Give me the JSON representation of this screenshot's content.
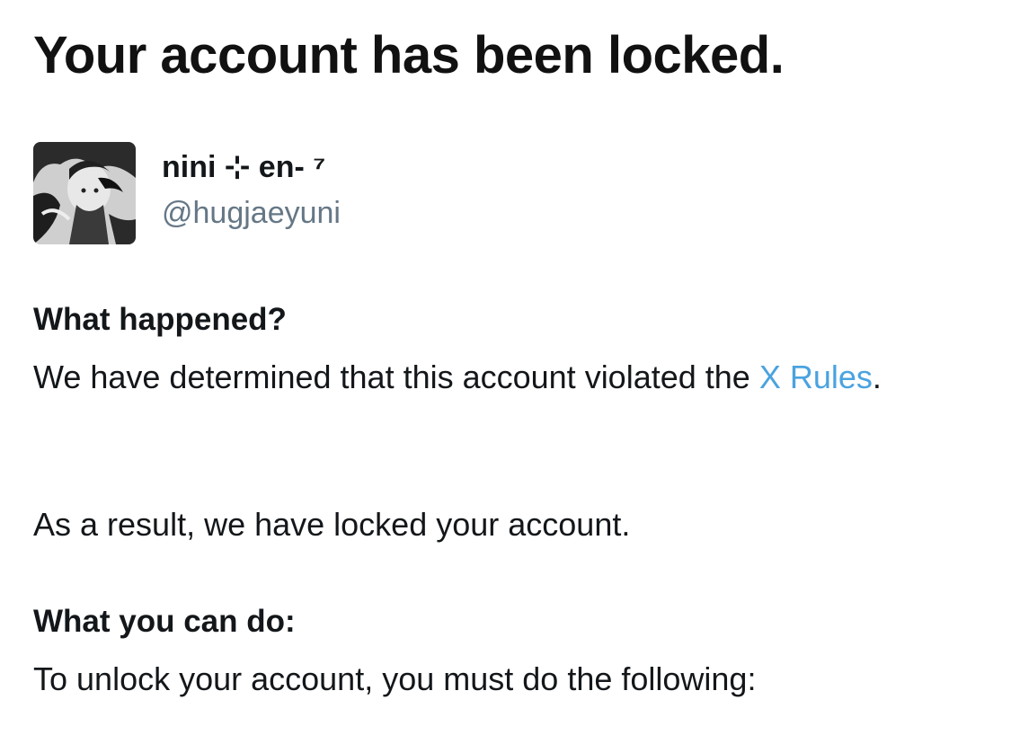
{
  "notice": {
    "title": "Your account has been locked."
  },
  "account": {
    "display_name": "nini ⊹ en- ⁷",
    "handle": "@hugjaeyuni"
  },
  "what_happened": {
    "heading": "What happened?",
    "text_before_link": "We have determined that this account violated the ",
    "link_text": "X Rules",
    "text_after_link": ".",
    "result_text": "As a result, we have locked your account."
  },
  "what_you_can_do": {
    "heading": "What you can do:",
    "text": "To unlock your account, you must do the following:"
  },
  "colors": {
    "text": "#14171a",
    "secondary_text": "#657786",
    "link": "#4aa3df",
    "background": "#ffffff"
  }
}
